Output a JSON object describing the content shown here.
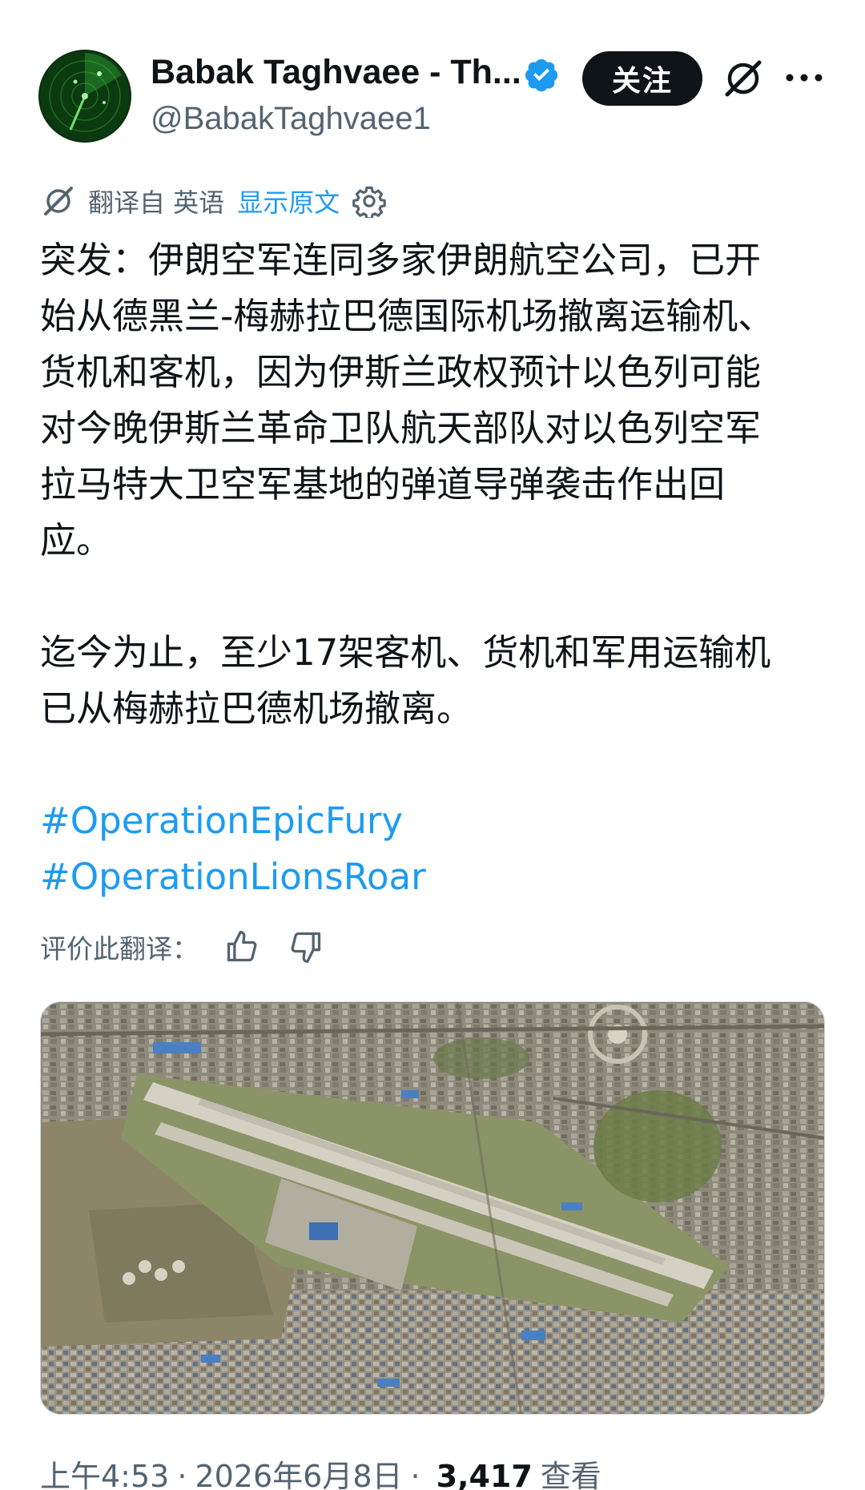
{
  "author": {
    "display_name": "Babak Taghvaee - Th...",
    "handle": "@BabakTaghvaee1",
    "verified": true,
    "verified_color": "#1d9bf0"
  },
  "header_actions": {
    "follow_label": "关注",
    "grok_icon": "grok-icon",
    "more_icon": "more-horizontal-icon"
  },
  "translation": {
    "label": "翻译自 英语",
    "show_original": "显示原文",
    "settings_icon": "gear-icon"
  },
  "post": {
    "paragraph1_lines": [
      "突发：伊朗空军连同多家伊朗航空公司，已开",
      "始从德黑兰-梅赫拉巴德国际机场撤离运输机、",
      "货机和客机，因为伊斯兰政权预计以色列可能",
      "对今晚伊斯兰革命卫队航天部队对以色列空军",
      "拉马特大卫空军基地的弹道导弹袭击作出回",
      "应。"
    ],
    "paragraph2_lines": [
      "迄今为止，至少17架客机、货机和军用运输机",
      "已从梅赫拉巴德机场撤离。"
    ],
    "hashtags": [
      "#OperationEpicFury",
      "#OperationLionsRoar"
    ]
  },
  "rate_translation": {
    "label": "评价此翻译：",
    "like_icon": "thumbs-up-icon",
    "dislike_icon": "thumbs-down-icon"
  },
  "media": {
    "description_icon": "satellite-image"
  },
  "meta": {
    "time": "上午4:53",
    "date": "2026年6月8日",
    "views_count": "3,417",
    "views_label": "查看"
  },
  "colors": {
    "text": "#0f1419",
    "secondary": "#536471",
    "link": "#1d9bf0",
    "button_bg": "#0f1419"
  }
}
